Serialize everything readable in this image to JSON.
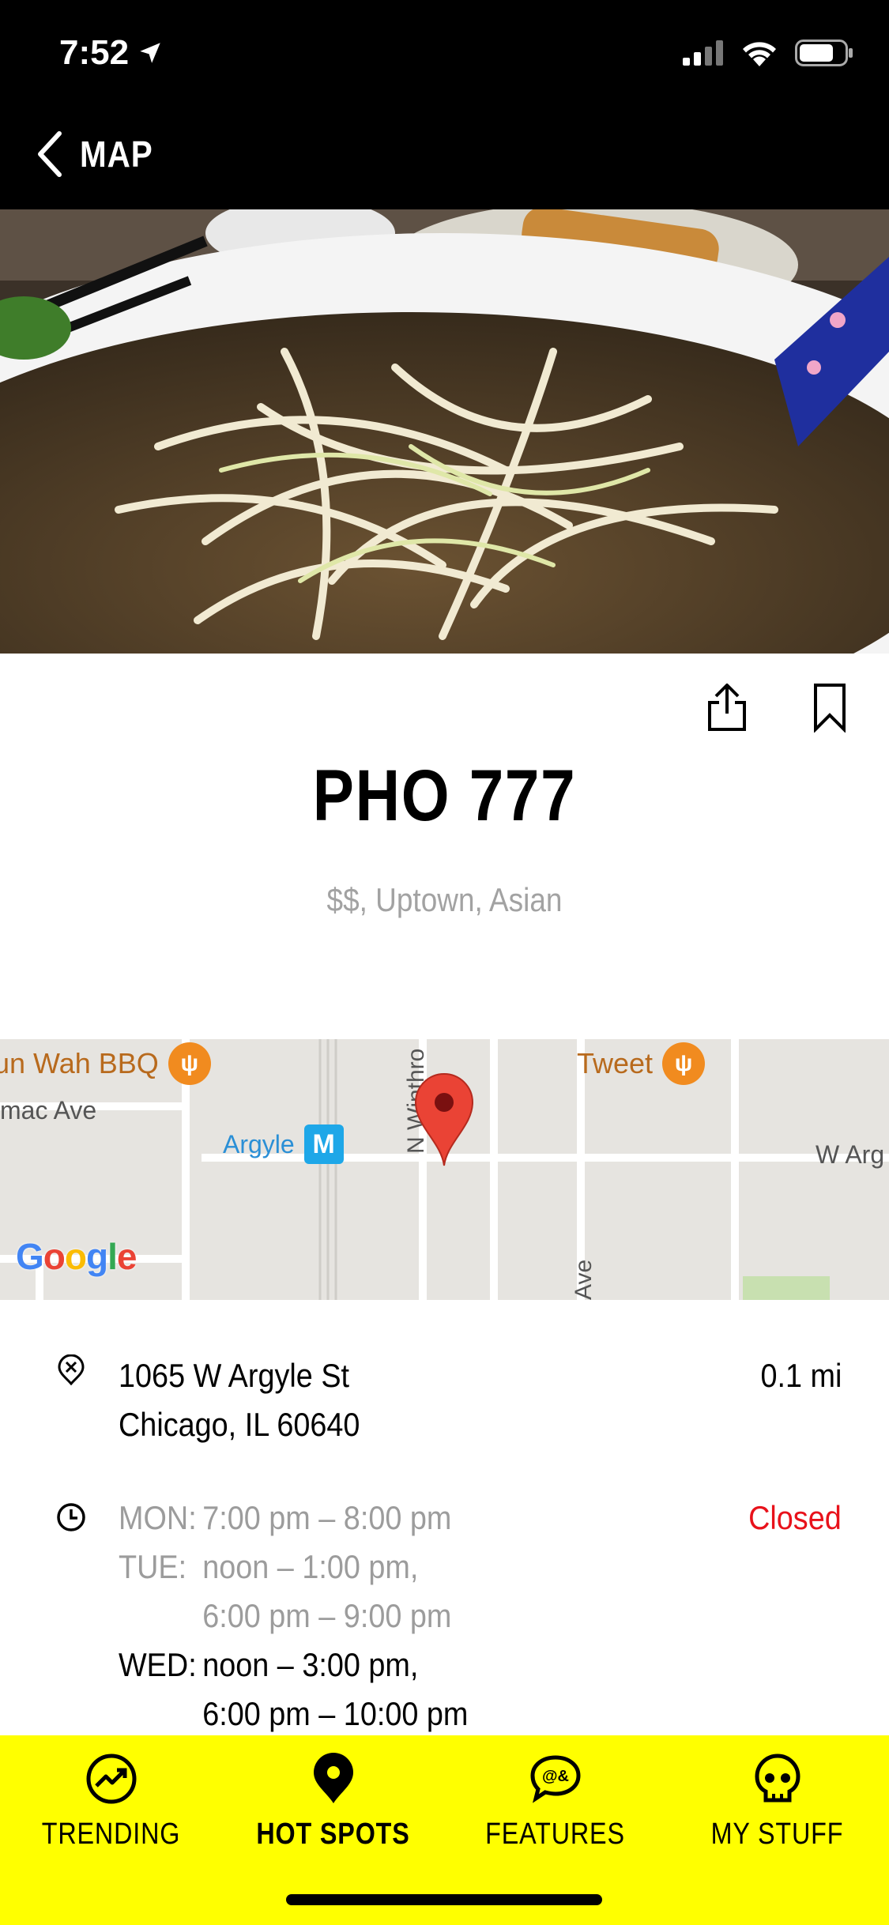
{
  "status_bar": {
    "time": "7:52"
  },
  "nav": {
    "back_label": "MAP"
  },
  "restaurant": {
    "name": "PHO 777",
    "meta": "$$, Uptown, Asian"
  },
  "map": {
    "labels": {
      "sun_wah": "un Wah BBQ",
      "tweet": "Tweet",
      "ainslie": "mac Ave",
      "argyle_station": "Argyle",
      "w_argyle": "W Arg",
      "winthrop": "N Winthro",
      "ave": "Ave"
    },
    "attribution": "Google"
  },
  "address": {
    "line1": "1065 W Argyle St",
    "line2": "Chicago, IL 60640",
    "distance": "0.1 mi"
  },
  "hours": {
    "status": "Closed",
    "rows": [
      {
        "day": "MON:",
        "time": "7:00 pm – 8:00 pm",
        "current": false
      },
      {
        "day": "TUE:",
        "time": "noon – 1:00 pm,",
        "current": false
      },
      {
        "day": "",
        "time": "6:00 pm – 9:00 pm",
        "current": false
      },
      {
        "day": "WED:",
        "time": "noon – 3:00 pm,",
        "current": true
      },
      {
        "day": "",
        "time": "6:00 pm – 10:00 pm",
        "current": true
      }
    ]
  },
  "tabs": [
    {
      "label": "TRENDING",
      "icon": "trending-icon",
      "active": false
    },
    {
      "label": "HOT SPOTS",
      "icon": "map-pin-icon",
      "active": true
    },
    {
      "label": "FEATURES",
      "icon": "features-icon",
      "active": false
    },
    {
      "label": "MY STUFF",
      "icon": "skull-icon",
      "active": false
    }
  ],
  "colors": {
    "tabbar": "#ffff00",
    "closed": "#e8121b",
    "muted": "#a2a2a2"
  }
}
